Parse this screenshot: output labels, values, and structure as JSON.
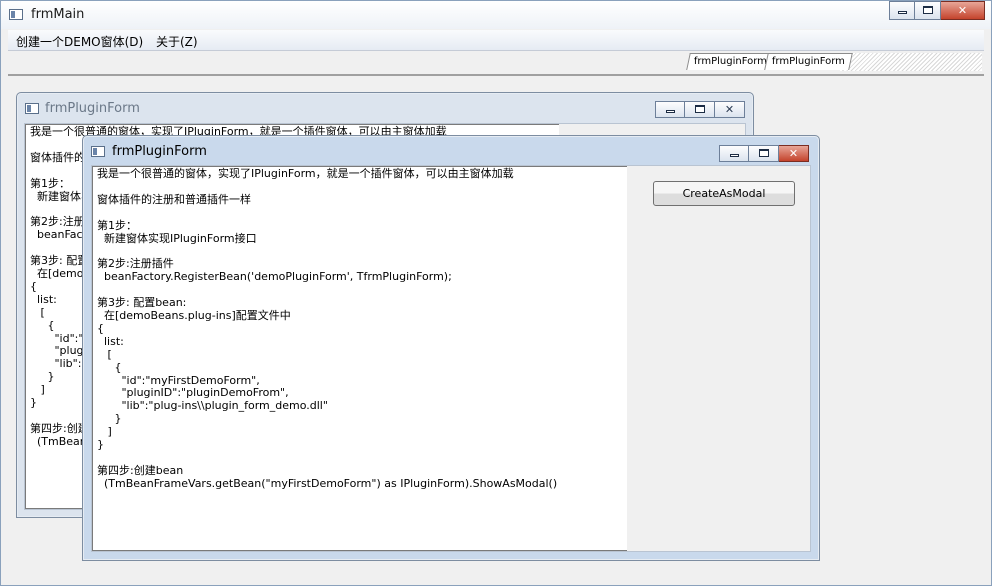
{
  "main_window": {
    "title": "frmMain",
    "caption_buttons": {
      "minimize": "▁",
      "maximize": "□",
      "close": "✕"
    }
  },
  "menu": {
    "items": [
      {
        "label": "创建一个DEMO窗体(D)"
      },
      {
        "label": "关于(Z)"
      }
    ]
  },
  "tabs": [
    {
      "label": "frmPluginForm"
    },
    {
      "label": "frmPluginForm"
    }
  ],
  "back_form": {
    "title": "frmPluginForm",
    "memo_lines": [
      "我是一个很普通的窗体，实现了IPluginForm，就是一个插件窗体，可以由主窗体加载",
      "",
      "窗体插件的注册和普通插件一样",
      "",
      "第1步：",
      "  新建窗体实现IPluginForm接口",
      "",
      "第2步:注册插件",
      "  beanFactory.RegisterBean('demoPluginForm', TfrmPluginForm);",
      "",
      "第3步: 配置bean:",
      "  在[demoBeans.plug-ins]配置文件中",
      "{",
      "  list:",
      "   [",
      "     {",
      "       \"id\":\"myFirstDemoForm\",",
      "       \"pluginID\":\"pluginDemoFrom\",",
      "       \"lib\":\"plug-ins\\\\plugin_form_demo.dll\"",
      "     }",
      "   ]",
      "}",
      "",
      "第四步:创建bean",
      "  (TmBeanFrameVars.getBean(\"myFirstDemoForm\") as IPluginForm).ShowAsModal()"
    ]
  },
  "front_form": {
    "title": "frmPluginForm",
    "memo_lines": [
      "我是一个很普通的窗体，实现了IPluginForm，就是一个插件窗体，可以由主窗体加载",
      "",
      "窗体插件的注册和普通插件一样",
      "",
      "第1步：",
      "  新建窗体实现IPluginForm接口",
      "",
      "第2步:注册插件",
      "  beanFactory.RegisterBean('demoPluginForm', TfrmPluginForm);",
      "",
      "第3步: 配置bean:",
      "  在[demoBeans.plug-ins]配置文件中",
      "{",
      "  list:",
      "   [",
      "     {",
      "       \"id\":\"myFirstDemoForm\",",
      "       \"pluginID\":\"pluginDemoFrom\",",
      "       \"lib\":\"plug-ins\\\\plugin_form_demo.dll\"",
      "     }",
      "   ]",
      "}",
      "",
      "第四步:创建bean",
      "  (TmBeanFrameVars.getBean(\"myFirstDemoForm\") as IPluginForm).ShowAsModal()"
    ],
    "button_label": "CreateAsModal"
  }
}
